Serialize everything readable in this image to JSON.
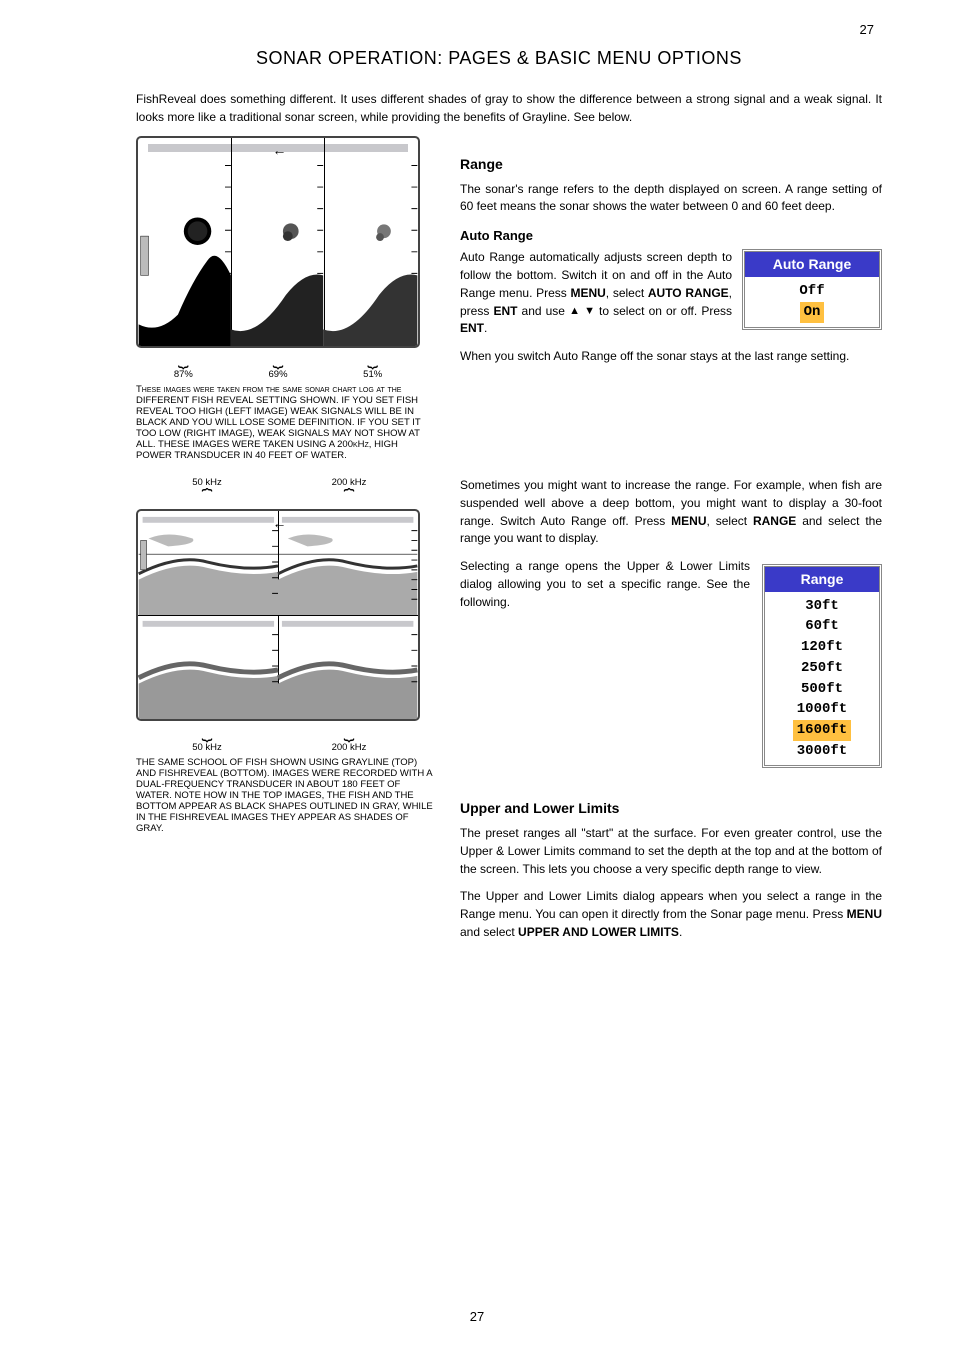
{
  "pageNumberTopRight": "27",
  "sectionTitle": "SONAR OPERATION: PAGES & BASIC MENU OPTIONS",
  "intro": "FishReveal does something different. It uses different shades of gray to show the difference between a strong signal and a weak signal. It looks more like a traditional sonar screen, while providing the benefits of Grayline. See below.",
  "figureA": {
    "arrow": "←",
    "labels": [
      "87%",
      "69%",
      "51%"
    ],
    "caption": "These images were taken from the same sonar chart log at the DIFFERENT FISH REVEAL SETTING SHOWN. IF YOU SET FISH REVEAL TOO HIGH (LEFT IMAGE) WEAK SIGNALS WILL BE IN BLACK AND YOU WILL LOSE SOME DEFINITION. IF YOU SET IT TOO LOW (RIGHT IMAGE), WEAK SIGNALS MAY NOT SHOW AT ALL. THESE IMAGES WERE TAKEN USING A 200kHz, HIGH POWER TRANSDUCER IN 40 FEET OF WATER."
  },
  "figureB": {
    "arrow": "←",
    "topLabels": [
      "50 kHz",
      "200 kHz"
    ],
    "bottomLabels": [
      "50 kHz",
      "200 kHz"
    ],
    "caption": "THE SAME SCHOOL OF FISH SHOWN USING GRAYLINE (TOP) AND FISHREVEAL (BOTTOM). IMAGES WERE RECORDED WITH A DUAL-FREQUENCY TRANSDUCER IN ABOUT 180 FEET OF WATER. NOTE HOW IN THE TOP IMAGES, THE FISH AND THE BOTTOM APPEAR AS BLACK SHAPES OUTLINED IN GRAY, WHILE IN THE FISHREVEAL IMAGES THEY APPEAR AS SHADES OF GRAY."
  },
  "range": {
    "heading": "Range",
    "p1": "The sonar's range refers to the depth displayed on screen. A range setting of 60 feet means the sonar shows the water between 0 and 60 feet deep.",
    "autoHeading": "Auto Range",
    "autoMenuTitle": "Auto Range",
    "autoOptions": [
      "Off",
      "On"
    ],
    "autoSelectedIndex": 1,
    "p2a": "Auto Range automatically adjusts screen depth to follow the bottom. Switch it on and off in the Auto Range menu. Press ",
    "menuKey": "MENU",
    "p2b": ", select ",
    "autoRangeText": "AUTO RANGE",
    "p2c": ", press ",
    "entKey": "ENT",
    "p2d": " and use ",
    "p2e": " to select on or off. Press ",
    "p2f": ".",
    "p3": "When you switch Auto Range off the sonar stays at the last range setting.",
    "p4a": "Sometimes you might want to increase the range. For example, when fish are suspended well above a deep bottom, you might want to display a 30-foot range. Switch Auto Range off. Press ",
    "p4b": ", select ",
    "rangeText": "RANGE",
    "p4c": " and select the range you want to display.",
    "rangeMenuTitle": "Range",
    "rangeOptions": [
      "30ft",
      "60ft",
      "120ft",
      "250ft",
      "500ft",
      "1000ft",
      "1600ft",
      "3000ft"
    ],
    "rangeSelectedIndex": 6,
    "p5": "Selecting a range opens the Upper & Lower Limits dialog allowing you to set a specific range. See the following."
  },
  "upperLower": {
    "heading": "Upper and Lower Limits",
    "p1": "The preset ranges all \"start\" at the surface. For even greater control, use the Upper & Lower Limits command to set the depth at the top and at the bottom of the screen. This lets you choose a very specific depth range to view.",
    "p2a": "The Upper and Lower Limits dialog appears when you select a range in the Range menu. You can open it directly from the Sonar page menu. Press ",
    "p2b": " and select ",
    "ulText": "UPPER AND LOWER LIMITS",
    "p2c": "."
  },
  "pageNumberBottom": "27"
}
